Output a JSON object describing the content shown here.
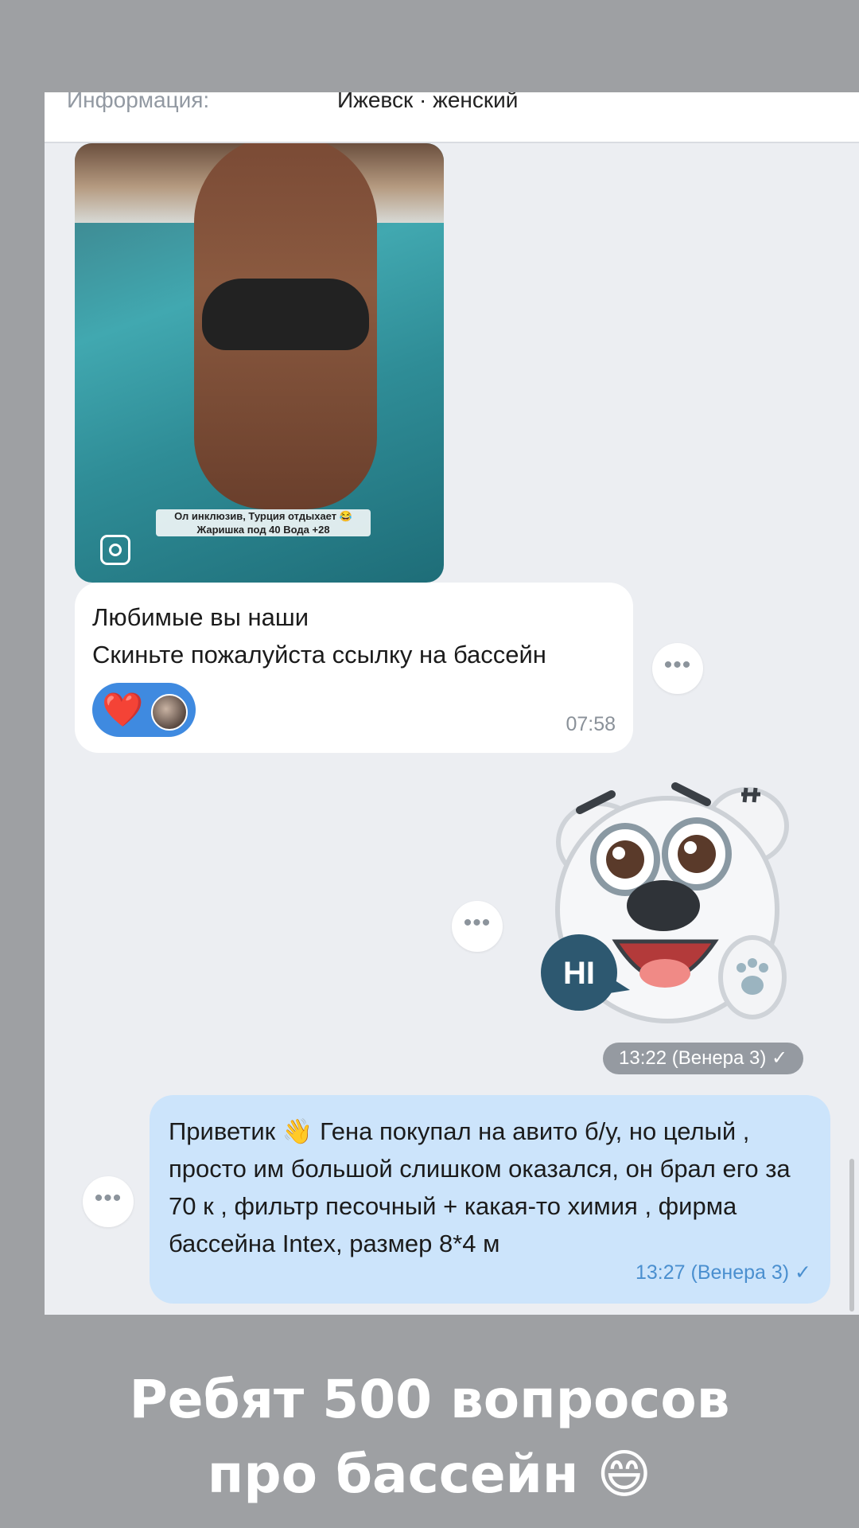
{
  "info": {
    "label": "Информация:",
    "value": "Ижевск · женский"
  },
  "photo_message": {
    "caption": "Ол инклюзив, Турция отдыхает 😂\nЖаришка под 40 Вода +28",
    "icon": "instagram-icon"
  },
  "incoming_message": {
    "text": "Любимые вы наши\nСкиньте пожалуйста ссылку на бассейн",
    "reaction": "❤️",
    "time": "07:58"
  },
  "sticker_message": {
    "sticker_text": "HI",
    "time": "13:22 (Венера 3) ✓"
  },
  "outgoing_message": {
    "text": "Приветик 👋 Гена покупал на авито б/у, но целый , просто им большой слишком оказался, он брал его за 70 к , фильтр песочный + какая-то химия , фирма бассейна Intex, размер 8*4 м",
    "time": "13:27 (Венера 3) ✓"
  },
  "more_label": "•••",
  "overlay": {
    "text": "Ребят 500 вопросов\nпро бассейн 😄"
  },
  "colors": {
    "outgoing_bubble": "#cce4fb",
    "incoming_bubble": "#ffffff",
    "reaction_pill": "#3f8ae0",
    "background": "#eceef2"
  }
}
